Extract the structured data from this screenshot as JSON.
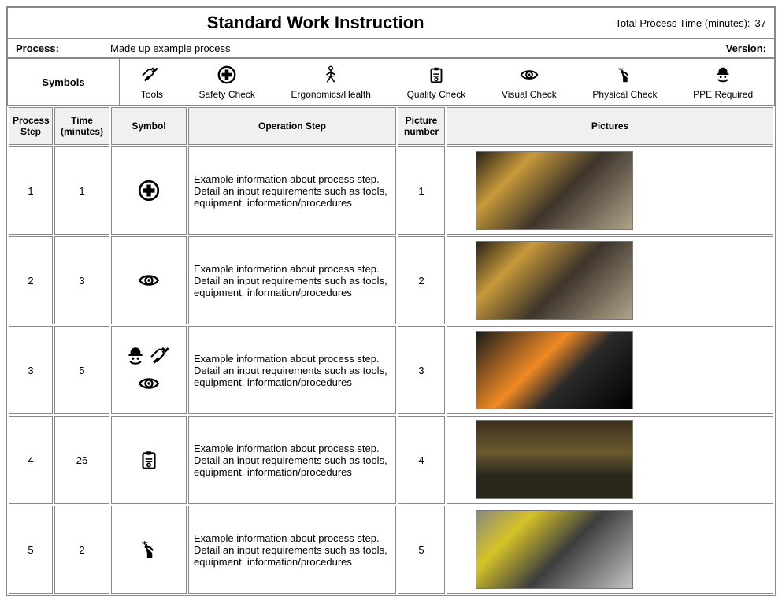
{
  "header": {
    "title": "Standard Work Instruction",
    "total_time_label": "Total Process Time (minutes):",
    "total_time_value": "37"
  },
  "process": {
    "label": "Process:",
    "value": "Made up example process",
    "version_label": "Version:",
    "version_value": ""
  },
  "legend": {
    "heading": "Symbols",
    "items": [
      {
        "name": "tools-icon",
        "label": "Tools"
      },
      {
        "name": "safety-check-icon",
        "label": "Safety Check"
      },
      {
        "name": "ergonomics-icon",
        "label": "Ergonomics/Health"
      },
      {
        "name": "quality-check-icon",
        "label": "Quality Check"
      },
      {
        "name": "visual-check-icon",
        "label": "Visual Check"
      },
      {
        "name": "physical-check-icon",
        "label": "Physical Check"
      },
      {
        "name": "ppe-required-icon",
        "label": "PPE Required"
      }
    ]
  },
  "columns": {
    "step": "Process Step",
    "time": "Time (minutes)",
    "symbol": "Symbol",
    "operation": "Operation Step",
    "picnum": "Picture number",
    "pictures": "Pictures"
  },
  "rows": [
    {
      "step": "1",
      "time": "1",
      "symbols": [
        "safety-check-icon"
      ],
      "operation": "Example information about process step. Detail an input requirements such as tools, equipment, information/procedures",
      "picnum": "1",
      "selected": false,
      "pic_class": "alt1"
    },
    {
      "step": "2",
      "time": "3",
      "symbols": [
        "visual-check-icon"
      ],
      "operation": "Example information about process step. Detail an input requirements such as tools, equipment, information/procedures",
      "picnum": "2",
      "selected": false,
      "pic_class": "alt1"
    },
    {
      "step": "3",
      "time": "5",
      "symbols": [
        "ppe-required-icon",
        "tools-icon",
        "visual-check-icon"
      ],
      "operation": "Example information about process step. Detail an input requirements such as tools, equipment, information/procedures",
      "picnum": "3",
      "selected": true,
      "pic_class": "alt2"
    },
    {
      "step": "4",
      "time": "26",
      "symbols": [
        "quality-check-icon"
      ],
      "operation": "Example information about process step. Detail an input requirements such as tools, equipment, information/procedures",
      "picnum": "4",
      "selected": false,
      "pic_class": "alt3"
    },
    {
      "step": "5",
      "time": "2",
      "symbols": [
        "physical-check-icon"
      ],
      "operation": "Example information about process step. Detail an input requirements such as tools, equipment, information/procedures",
      "picnum": "5",
      "selected": false,
      "pic_class": "alt4"
    }
  ]
}
